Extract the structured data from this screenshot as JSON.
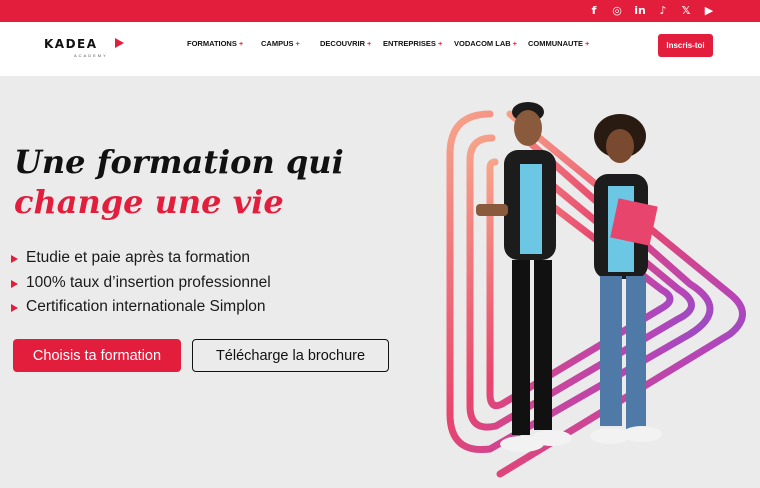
{
  "topbar": {
    "socials": [
      {
        "icon": "facebook-icon",
        "glyph": "f"
      },
      {
        "icon": "instagram-icon",
        "glyph": "◎"
      },
      {
        "icon": "linkedin-icon",
        "glyph": "in"
      },
      {
        "icon": "tiktok-icon",
        "glyph": "♪"
      },
      {
        "icon": "x-icon",
        "glyph": "𝕏"
      },
      {
        "icon": "youtube-icon",
        "glyph": "▶"
      }
    ]
  },
  "brand": {
    "name": "KADEA",
    "subtitle": "ACADEMY",
    "accent": "#e31e3d"
  },
  "nav": {
    "items": [
      {
        "label": "FORMATIONS",
        "plus": "+"
      },
      {
        "label": "CAMPUS",
        "plus": "+"
      },
      {
        "label": "DECOUVRIR",
        "plus": "+"
      },
      {
        "label": "ENTREPRISES",
        "plus": "+"
      },
      {
        "label": "VODACOM LAB",
        "plus": "+"
      },
      {
        "label": "COMMUNAUTE",
        "plus": "+"
      }
    ],
    "cta": "Inscris-toi"
  },
  "hero": {
    "title_line1": "Une formation qui",
    "title_line2": "change une vie",
    "bullets": [
      "Etudie et paie après ta formation",
      "100% taux d’insertion professionnel",
      "Certification internationale Simplon"
    ],
    "primary_button": "Choisis ta formation",
    "secondary_button": "Télécharge la brochure"
  }
}
